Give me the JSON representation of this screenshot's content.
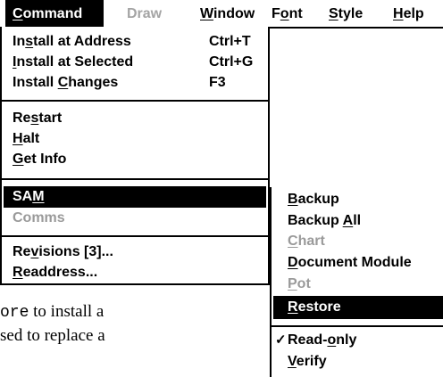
{
  "menubar": {
    "items": [
      {
        "label": "Command",
        "ul": "C",
        "rest": "ommand",
        "state": "active"
      },
      {
        "label": "Draw",
        "state": "disabled"
      },
      {
        "label": "Window",
        "ul": "W",
        "rest": "indow",
        "state": "normal"
      },
      {
        "label": "Font",
        "pre": "F",
        "ul": "o",
        "rest": "nt",
        "state": "normal"
      },
      {
        "label": "Style",
        "ul": "S",
        "rest": "tyle",
        "state": "normal"
      },
      {
        "label": "Help",
        "ul": "H",
        "rest": "elp",
        "state": "normal"
      }
    ]
  },
  "command_menu": {
    "group1": [
      {
        "pre": "In",
        "ul": "s",
        "rest": "tall at Address",
        "shortcut": "Ctrl+T"
      },
      {
        "pre": "",
        "ul": "I",
        "rest": "nstall at Selected",
        "shortcut": "Ctrl+G"
      },
      {
        "pre": "Install ",
        "ul": "C",
        "rest": "hanges",
        "shortcut": "F3"
      }
    ],
    "group2": [
      {
        "pre": "Re",
        "ul": "s",
        "rest": "tart"
      },
      {
        "pre": "",
        "ul": "H",
        "rest": "alt"
      },
      {
        "pre": "",
        "ul": "G",
        "rest": "et Info"
      }
    ],
    "group3": [
      {
        "pre": "SA",
        "ul": "M",
        "rest": "",
        "state": "highlighted"
      },
      {
        "pre": "Comms",
        "ul": "",
        "rest": "",
        "state": "disabled"
      }
    ],
    "group4": [
      {
        "pre": "Re",
        "ul": "v",
        "rest": "isions [3]..."
      },
      {
        "pre": "",
        "ul": "R",
        "rest": "eaddress..."
      }
    ]
  },
  "sam_submenu": {
    "items": [
      {
        "pre": "",
        "ul": "B",
        "rest": "ackup",
        "state": "normal"
      },
      {
        "pre": "Backup ",
        "ul": "A",
        "rest": "ll",
        "state": "normal"
      },
      {
        "pre": "",
        "ul": "C",
        "rest": "hart",
        "state": "disabled"
      },
      {
        "pre": "",
        "ul": "D",
        "rest": "ocument Module",
        "state": "normal"
      },
      {
        "pre": "",
        "ul": "P",
        "rest": "ot",
        "state": "disabled"
      },
      {
        "pre": "",
        "ul": "R",
        "rest": "estore",
        "state": "highlighted"
      },
      {
        "pre": "Read-",
        "ul": "o",
        "rest": "nly",
        "state": "checked",
        "check": "✓"
      },
      {
        "pre": "",
        "ul": "V",
        "rest": "erify",
        "state": "normal"
      }
    ]
  },
  "background_doc": {
    "line1_code": "ore",
    "line1_text": " to install a",
    "line2_text": "sed to replace a"
  }
}
